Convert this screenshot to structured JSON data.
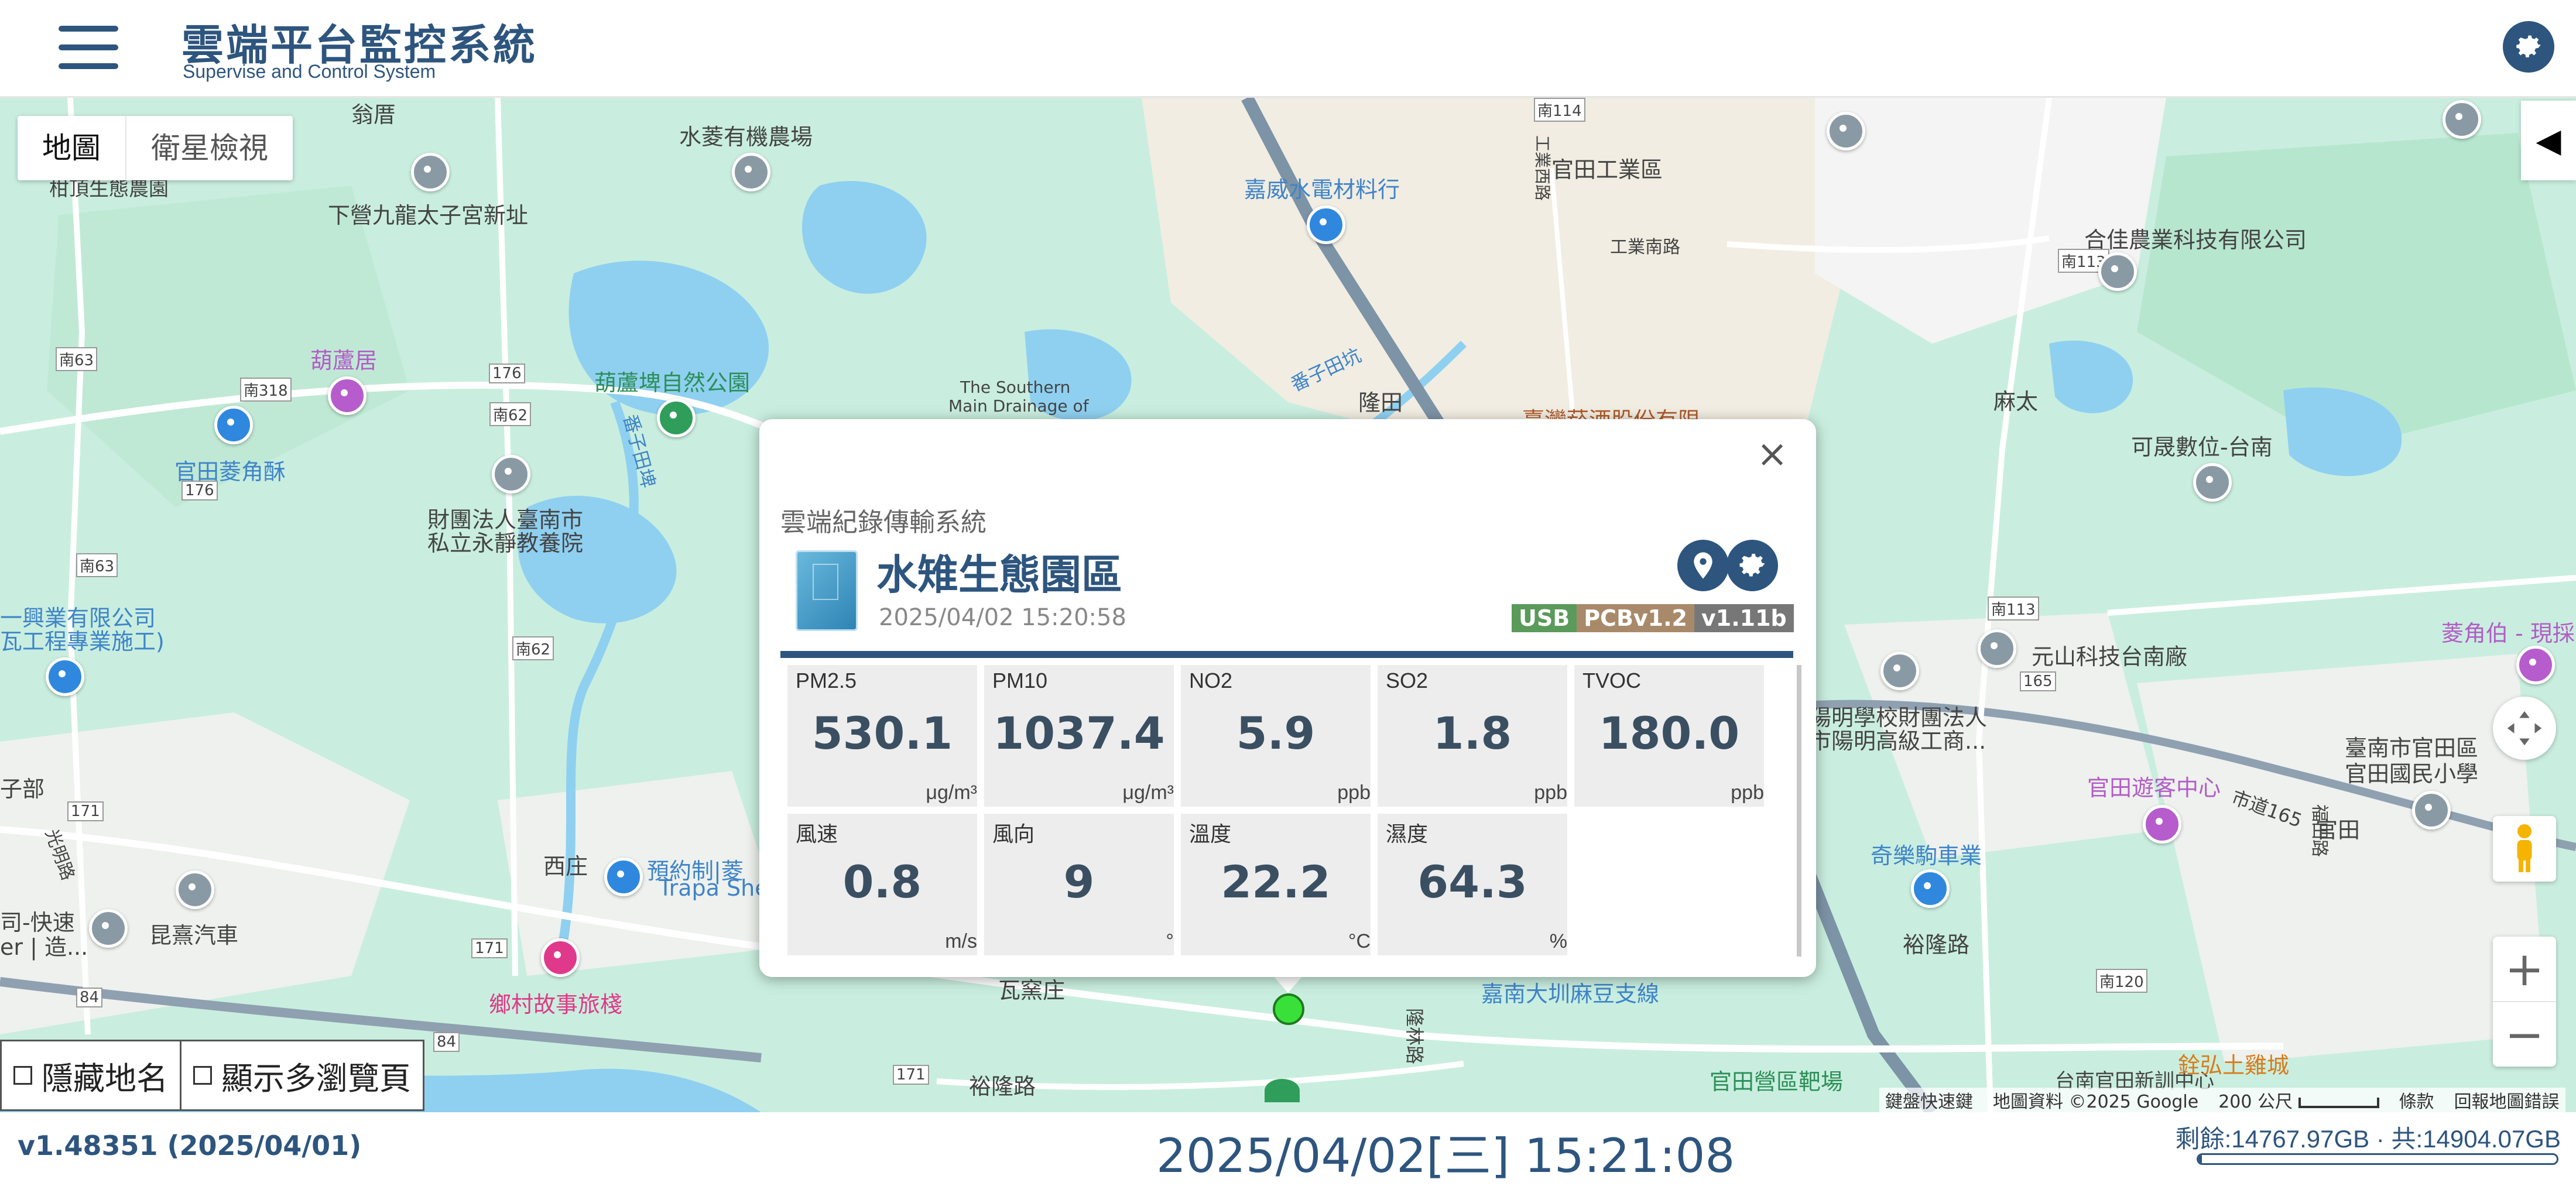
{
  "header": {
    "title": "雲端平台監控系統",
    "subtitle": "Supervise and Control System",
    "menu_icon": "hamburger-icon",
    "settings_icon": "gear-icon"
  },
  "map": {
    "type_buttons": [
      "地圖",
      "衛星檢視"
    ],
    "labels": {
      "l01": "翁厝",
      "l02": "水菱有機農場",
      "l03": "官田工業區",
      "l04": "工業南路",
      "l05": "嘉威水電材料行",
      "l06": "合佳農業科技有限公司",
      "l07": "下營九龍太子宮新址",
      "l08": "葫蘆居",
      "l09": "葫蘆埤自然公園",
      "l10": "官田菱角酥",
      "l11": "財團法人臺南市",
      "l12": "私立永靜教養院",
      "l13": "隆田",
      "l14": "麻太",
      "l15": "可晟數位-台南",
      "l16": "元山科技台南廠",
      "l17": "菱角伯 - 現採",
      "l18": "臺南市官田區",
      "l19": "官田國民小學",
      "l20": "官田遊客中心",
      "l21": "官田",
      "l22": "奇樂駒車業",
      "l23": "裕隆路",
      "l24": "西庄",
      "l25": "預約制|菱",
      "l26": "昆熹汽車",
      "l27": "鄉村故事旅棧",
      "l28": "瓦窯庄",
      "l29": "嘉南大圳麻豆支線",
      "l30": "官田營區靶場",
      "l31": "台南官田新訓中心",
      "l32": "銓弘土雞城",
      "l33": "一興業有限公司",
      "l34": "瓦工程專業施工)",
      "l35": "陽明學校財團法人",
      "l36": "市陽明高級工商...",
      "l37": "The Southern",
      "l38": "Main Drainage of",
      "l39": "番子田埤",
      "l40": "隆林路",
      "l41": "市道165",
      "l42": "臺灣菸酒股份有限",
      "l43": "南113",
      "l44": "南120",
      "l45": "南114",
      "l46": "南63",
      "l47": "南318",
      "l48": "南62",
      "l49": "171",
      "l50": "176",
      "l51": "84",
      "l52": "165",
      "l53": "Trapa She",
      "l54": "福田路",
      "l55": "工業西路",
      "l56": "番子田坑",
      "l57": "司-快速",
      "l58": "er | 造...",
      "l59": "光明路",
      "l60": "子部",
      "l61": "柑頂生態農園",
      "l62": "裕隆路",
      "l63": "1"
    },
    "checkboxes": [
      "隱藏地名",
      "顯示多瀏覽頁"
    ],
    "attribution": {
      "shortcuts": "鍵盤快速鍵",
      "data": "地圖資料 ©2025 Google",
      "scale": "200 公尺",
      "terms": "條款",
      "report": "回報地圖錯誤"
    },
    "zoom_in": "+",
    "zoom_out": "−",
    "collapse": "◀"
  },
  "popup": {
    "system": "雲端紀錄傳輸系統",
    "station": "水雉生態園區",
    "time": "2025/04/02 15:20:58",
    "badges": [
      {
        "text": "USB",
        "color": "#5a9a5a"
      },
      {
        "text": "PCBv1.2",
        "color": "#a88a6a"
      },
      {
        "text": "v1.11b",
        "color": "#777777"
      }
    ],
    "close": "×",
    "readings": [
      {
        "name": "PM2.5",
        "value": "530.1",
        "unit": "μg/m³"
      },
      {
        "name": "PM10",
        "value": "1037.4",
        "unit": "μg/m³"
      },
      {
        "name": "NO2",
        "value": "5.9",
        "unit": "ppb"
      },
      {
        "name": "SO2",
        "value": "1.8",
        "unit": "ppb"
      },
      {
        "name": "TVOC",
        "value": "180.0",
        "unit": "ppb"
      },
      {
        "name": "風速",
        "value": "0.8",
        "unit": "m/s"
      },
      {
        "name": "風向",
        "value": "9",
        "unit": "°"
      },
      {
        "name": "溫度",
        "value": "22.2",
        "unit": "°C"
      },
      {
        "name": "濕度",
        "value": "64.3",
        "unit": "%"
      }
    ]
  },
  "footer": {
    "version": "v1.48351 (2025/04/01)",
    "datetime": "2025/04/02[三] 15:21:08",
    "storage": "剩餘:14767.97GB · 共:14904.07GB",
    "storage_used_fraction": 0.0091
  }
}
